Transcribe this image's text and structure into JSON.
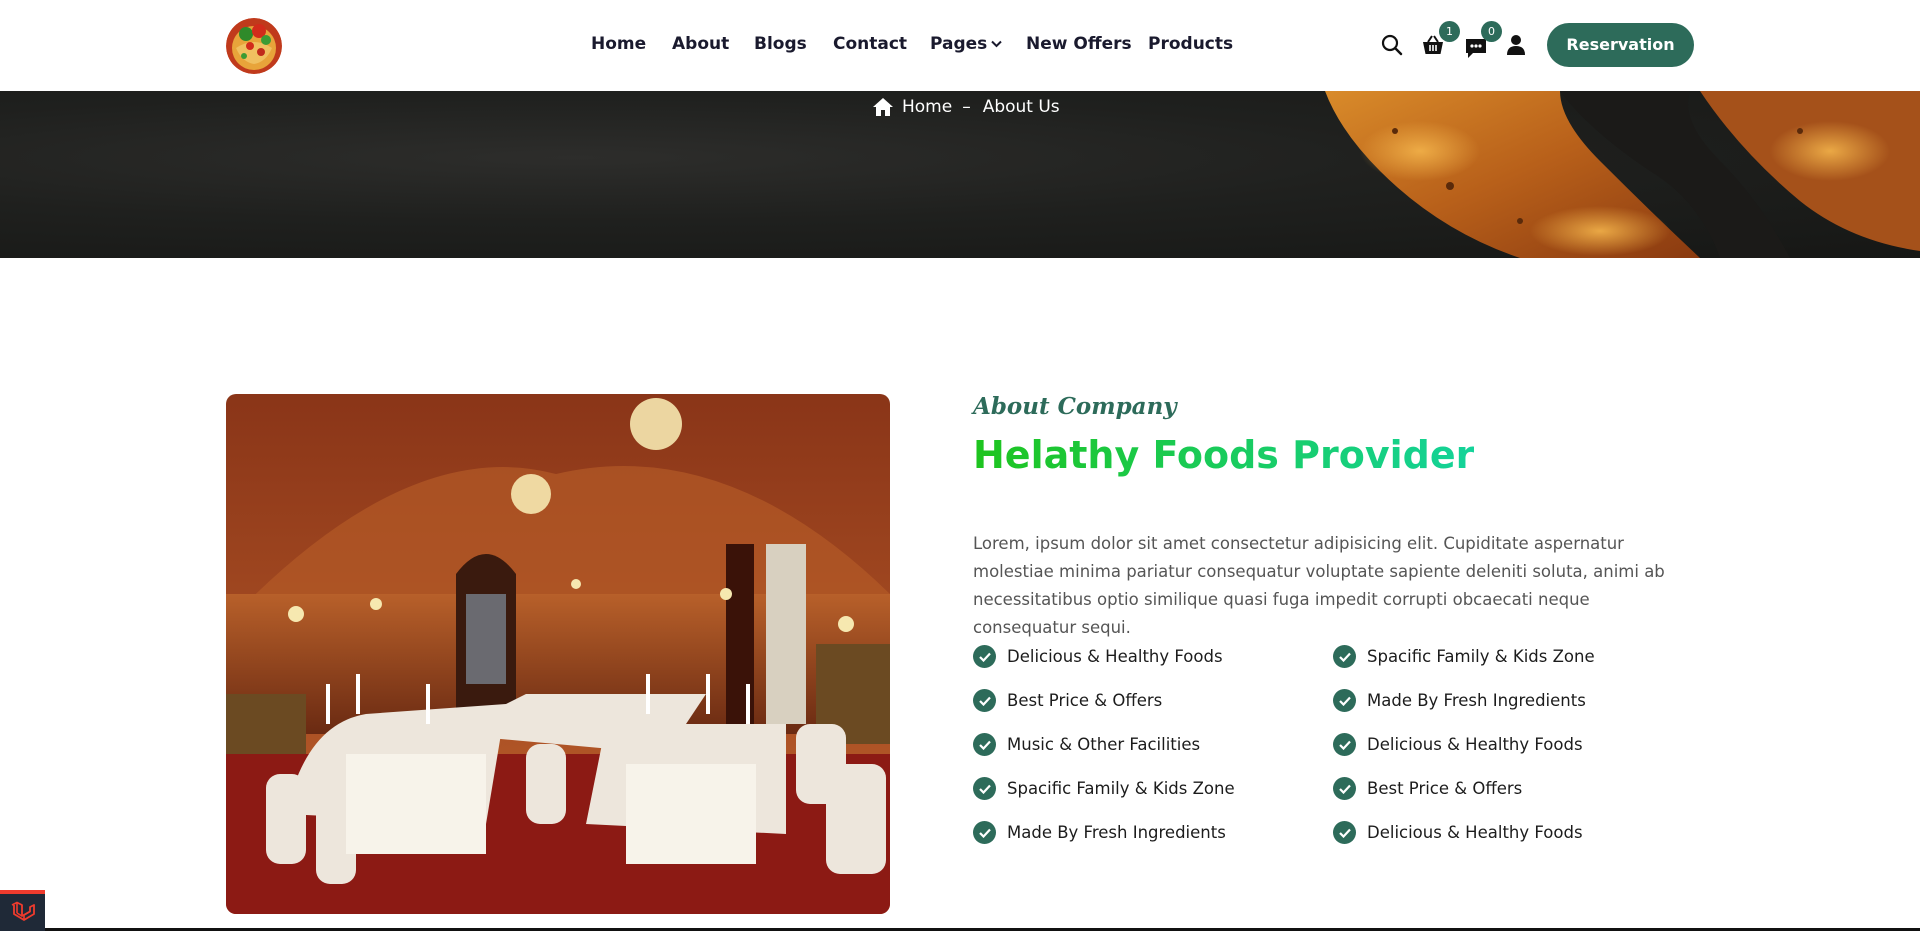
{
  "header": {
    "logo_icon": "food-plate-logo",
    "nav": [
      {
        "label": "Home"
      },
      {
        "label": "About"
      },
      {
        "label": "Blogs"
      },
      {
        "label": "Contact"
      },
      {
        "label": "Pages",
        "has_dropdown": true
      },
      {
        "label": "New Offers"
      },
      {
        "label": "Products"
      }
    ],
    "cart_count": "1",
    "message_count": "0",
    "reservation_label": "Reservation"
  },
  "banner": {
    "breadcrumb_home": "Home",
    "breadcrumb_sep": "–",
    "breadcrumb_current": "About Us"
  },
  "about": {
    "subtitle": "About Company",
    "title": "Helathy Foods Provider",
    "description": "Lorem, ipsum dolor sit amet consectetur adipisicing elit. Cupiditate aspernatur molestiae minima pariatur consequatur voluptate sapiente deleniti soluta, animi ab necessitatibus optio similique quasi fuga impedit corrupti obcaecati neque consequatur sequi.",
    "features_left": [
      "Delicious & Healthy Foods",
      "Best Price & Offers",
      "Music & Other Facilities",
      "Spacific Family & Kids Zone",
      "Made By Fresh Ingredients"
    ],
    "features_right": [
      "Spacific Family & Kids Zone",
      "Made By Fresh Ingredients",
      "Delicious & Healthy Foods",
      "Best Price & Offers",
      "Delicious & Healthy Foods"
    ]
  },
  "colors": {
    "primary": "#2d6b5a",
    "title_gradient_start": "#1ec41e",
    "title_gradient_end": "#14d39a"
  }
}
